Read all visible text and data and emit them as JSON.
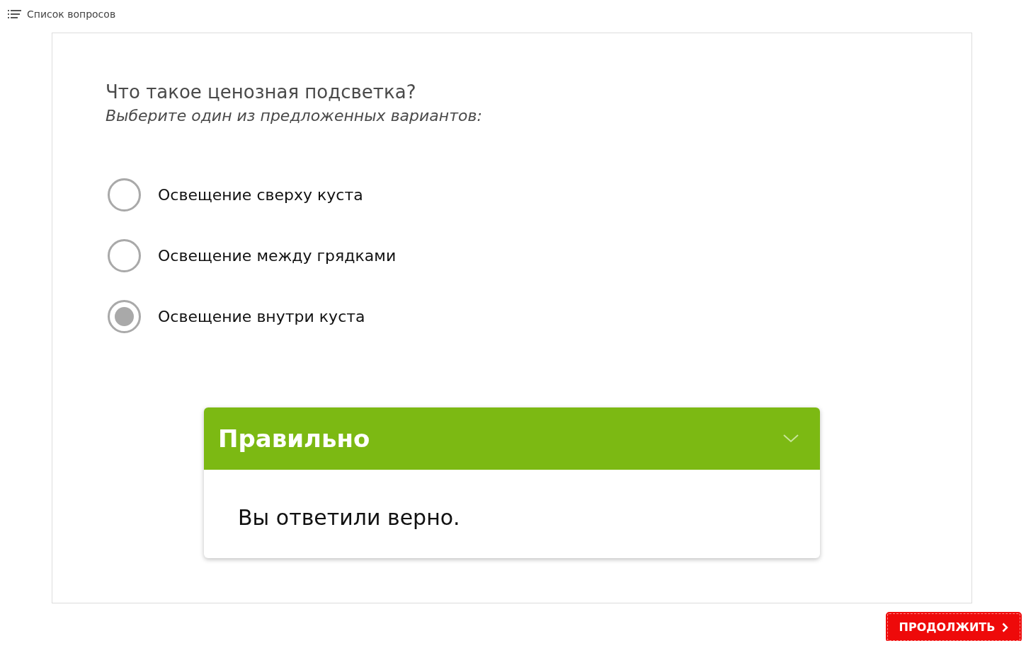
{
  "question_list_link": {
    "label": "Список вопросов"
  },
  "question": {
    "title": "Что такое ценозная подсветка?",
    "instruction": "Выберите один из предложенных вариантов:"
  },
  "options": [
    {
      "label": "Освещение сверху куста",
      "selected": false
    },
    {
      "label": "Освещение между грядками",
      "selected": false
    },
    {
      "label": "Освещение внутри куста",
      "selected": true
    }
  ],
  "feedback": {
    "title": "Правильно",
    "message": "Вы ответили верно.",
    "expanded": true
  },
  "continue_button": {
    "label": "ПРОДОЛЖИТЬ"
  }
}
